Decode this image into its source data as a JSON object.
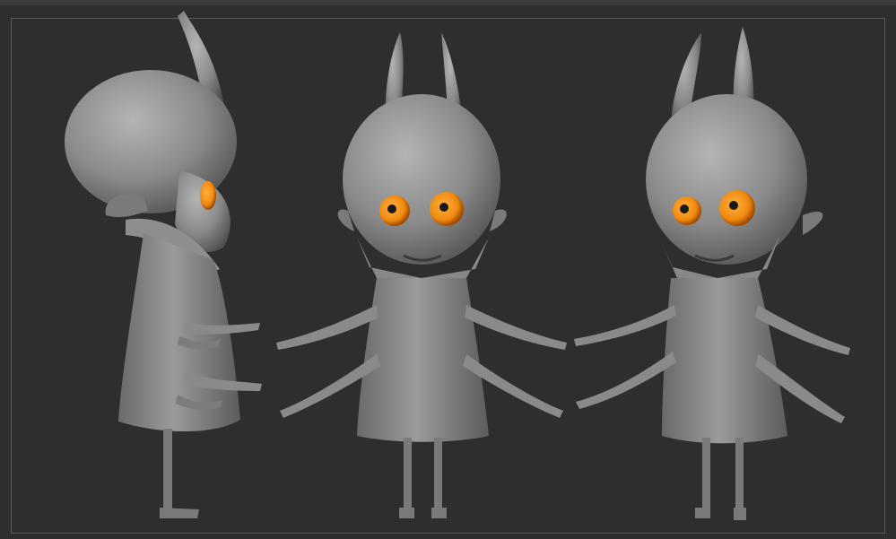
{
  "viewport": {
    "background": "#2e2e2e",
    "frame_color": "#5a5a5a"
  },
  "character": {
    "description_views": [
      "side-view",
      "front-view",
      "three-quarter-view"
    ],
    "body_color": "#8c8c8c",
    "eye_color": "#f08a10",
    "pupil_color": "#1a1a1a"
  }
}
